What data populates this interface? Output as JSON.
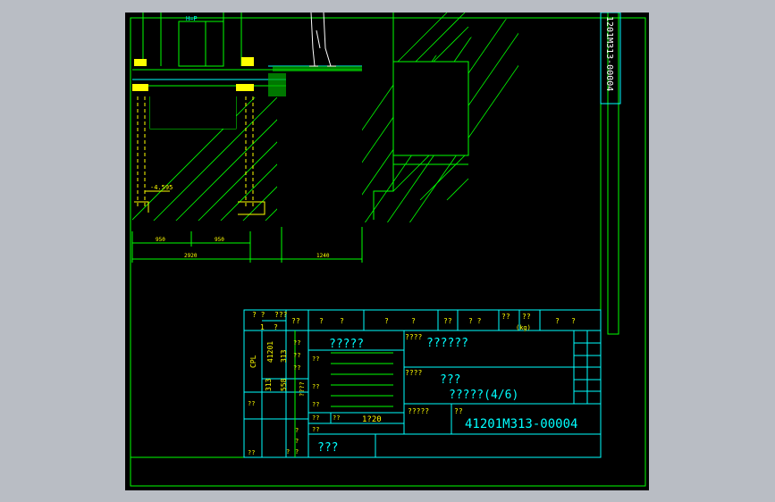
{
  "drawing": {
    "side_code": "1201M313-00004",
    "top_label": "H=P",
    "elevation_label": "-4.595",
    "dims": {
      "d1": "950",
      "d2": "950",
      "d3": "2920",
      "d4": "1240"
    }
  },
  "title_block": {
    "hdr": [
      "? ?",
      "???",
      "??",
      "?",
      "?",
      "?",
      "?",
      "??",
      "? ?",
      "??",
      "??",
      "(kg)",
      "?",
      "?"
    ],
    "hdr_one": "1",
    "hdr_two": "?",
    "rot": {
      "cpl": "CPL",
      "n1": "41201",
      "n2": "313",
      "n3": "313",
      "n4": "558"
    },
    "company": "?????",
    "name_code_label": "????",
    "name_code_value": "??????",
    "product_label": "????",
    "product_title": "???",
    "product_subtitle": "?????(4/6)",
    "drawing_no_label": "?????",
    "drawing_no_label2": "??",
    "drawing_no": "41201M313-00004",
    "scale": "1?20",
    "bottom": "???",
    "small": [
      "??",
      "??",
      "??",
      "??",
      "??",
      "??",
      "????",
      "??",
      "??",
      "??",
      "?",
      "?",
      "?",
      "?",
      "??",
      "??"
    ]
  },
  "colors": {
    "green": "#00ff00",
    "yellow": "#ffff00",
    "cyan": "#00ffff",
    "white": "#ffffff"
  }
}
